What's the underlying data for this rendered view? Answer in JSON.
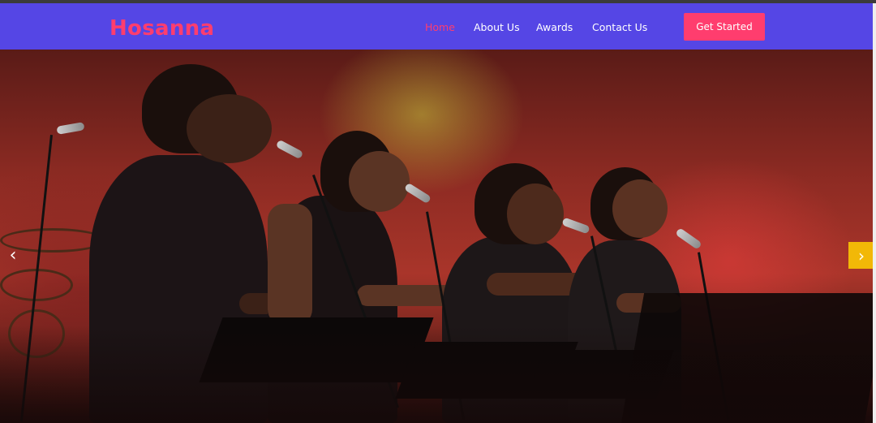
{
  "brand": {
    "name": "Hosanna",
    "color": "#ff3d6e"
  },
  "nav": {
    "bg_color": "#5546e5",
    "items": [
      {
        "label": "Home",
        "active": true
      },
      {
        "label": "About Us",
        "active": false
      },
      {
        "label": "Awards",
        "active": false
      },
      {
        "label": "Contact Us",
        "active": false
      }
    ],
    "cta_label": "Get Started",
    "cta_color": "#ff3d6e"
  },
  "hero": {
    "image_description_icon": "choir-performance-photo",
    "prev_icon": "chevron-left-icon",
    "next_icon": "chevron-right-icon",
    "next_bg": "#f2b807"
  }
}
